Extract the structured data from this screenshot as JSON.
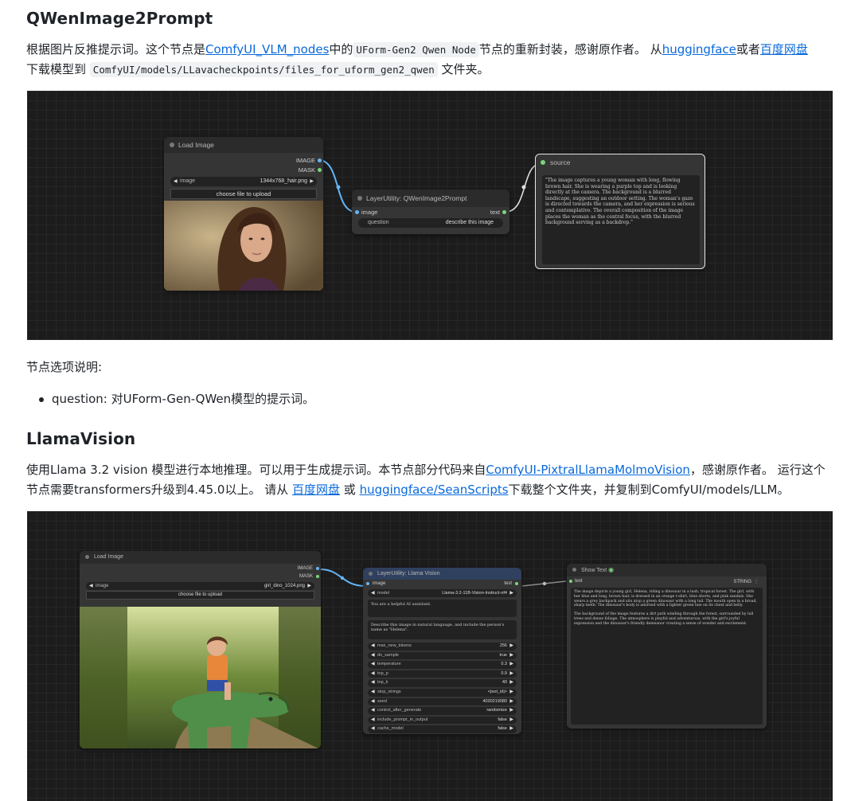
{
  "section1": {
    "heading": "QWenImage2Prompt",
    "p1_a": "根据图片反推提示词。这个节点是",
    "link_vlm": "ComfyUI_VLM_nodes",
    "p1_b": "中的",
    "code1": "UForm-Gen2 Qwen Node",
    "p1_c": "节点的重新封装，感谢原作者。 从",
    "link_hf": "huggingface",
    "p1_d": "或者",
    "link_baidu": "百度网盘",
    "p1_e": "下载模型到",
    "code2": "ComfyUI/models/LLavacheckpoints/files_for_uform_gen2_qwen",
    "p1_f": "文件夹。"
  },
  "canvas1": {
    "load_image": {
      "title": "Load Image",
      "out_image": "IMAGE",
      "out_mask": "MASK",
      "image_label": "image",
      "image_value": "1344x768_hair.png",
      "upload_label": "choose file to upload"
    },
    "qwen_node": {
      "title": "LayerUtility: QWenImage2Prompt",
      "in_image": "image",
      "out_text": "text",
      "question_label": "question",
      "question_value": "describe this image"
    },
    "source_node": {
      "title": "source",
      "text": "\"The image captures a young woman with long, flowing brown hair. She is wearing a purple top and is looking directly at the camera. The background is a blurred landscape, suggesting an outdoor setting. The woman's gaze is directed towards the camera, and her expression is serious and contemplative. The overall composition of the image places the woman as the central focus, with the blurred background serving as a backdrop.\""
    }
  },
  "options": {
    "heading": "节点选项说明:",
    "items": [
      "question: 对UForm-Gen-QWen模型的提示词。"
    ]
  },
  "section2": {
    "heading": "LlamaVision",
    "p_a": "使用Llama 3.2 vision 模型进行本地推理。可以用于生成提示词。本节点部分代码来自",
    "link_pixtral": "ComfyUI-PixtralLlamaMolmoVision",
    "p_b": "，感谢原作者。 运行这个节点需要transformers升级到4.45.0以上。 请从 ",
    "link_baidu": "百度网盘",
    "p_c": " 或 ",
    "link_hf": "huggingface/SeanScripts",
    "p_d": "下载整个文件夹，并复制到ComfyUI/models/LLM。"
  },
  "canvas2": {
    "load_image": {
      "title": "Load Image",
      "out_image": "IMAGE",
      "out_mask": "MASK",
      "image_label": "image",
      "image_value": "girl_dino_1024.png",
      "upload_label": "choose file to upload"
    },
    "llama_node": {
      "title": "LayerUtility: Llama Vision",
      "in_image": "image",
      "out_text": "text",
      "model_label": "model",
      "model_value": "Llama-3.2-11B-Vision-Instruct-nf4",
      "system_prompt": "You are a helpful AI assistant.",
      "user_prompt": "Describe this image in natural language, and include the person's name as \"Helena\".",
      "params": [
        {
          "label": "max_new_tokens",
          "value": "256"
        },
        {
          "label": "do_sample",
          "value": "true"
        },
        {
          "label": "temperature",
          "value": "0.3"
        },
        {
          "label": "top_p",
          "value": "0.9"
        },
        {
          "label": "top_k",
          "value": "40"
        },
        {
          "label": "stop_strings",
          "value": "<|eot_id|>"
        },
        {
          "label": "seed",
          "value": "403021908​0"
        },
        {
          "label": "control_after_generate",
          "value": "randomize"
        },
        {
          "label": "include_prompt_in_output",
          "value": "false"
        },
        {
          "label": "cache_model",
          "value": "false"
        }
      ]
    },
    "show_text": {
      "title": "Show Text",
      "in_text": "text",
      "out_string": "STRING",
      "text1": "The image depicts a young girl, Helena, riding a dinosaur in a lush, tropical forest. The girl, with her blue and long, brown hair, is dressed in an orange t-shirt, blue shorts, and pink sandals. She wears a grey backpack and sits atop a green dinosaur with a long tail. The mouth open in a broad, sharp teeth. The dinosaur's body is adorned with a lighter green hue on its chest and belly.",
      "text2": "The background of the image features a dirt path winding through the forest, surrounded by tall trees and dense foliage. The atmosphere is playful and adventurous, with the girl's joyful expression and the dinosaur's friendly demeanor creating a sense of wonder and excitement."
    }
  },
  "colors": {
    "link": "#0969da",
    "canvas_bg": "#1c1c1c",
    "node_bg": "#353535",
    "llama_title": "#30405f",
    "image_slot": "#64b5f6",
    "text_slot": "#7bd67b"
  }
}
